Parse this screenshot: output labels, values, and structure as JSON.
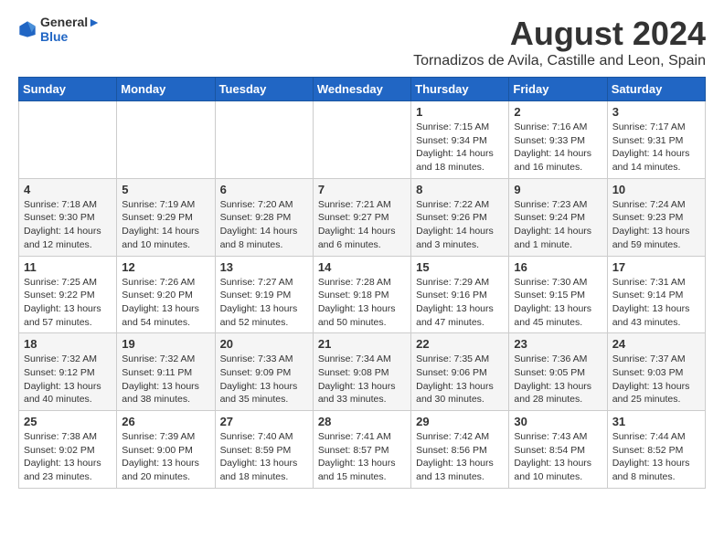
{
  "logo": {
    "line1": "General",
    "line2": "Blue"
  },
  "title": "August 2024",
  "subtitle": "Tornadizos de Avila, Castille and Leon, Spain",
  "days_of_week": [
    "Sunday",
    "Monday",
    "Tuesday",
    "Wednesday",
    "Thursday",
    "Friday",
    "Saturday"
  ],
  "weeks": [
    [
      {
        "day": "",
        "info": ""
      },
      {
        "day": "",
        "info": ""
      },
      {
        "day": "",
        "info": ""
      },
      {
        "day": "",
        "info": ""
      },
      {
        "day": "1",
        "info": "Sunrise: 7:15 AM\nSunset: 9:34 PM\nDaylight: 14 hours\nand 18 minutes."
      },
      {
        "day": "2",
        "info": "Sunrise: 7:16 AM\nSunset: 9:33 PM\nDaylight: 14 hours\nand 16 minutes."
      },
      {
        "day": "3",
        "info": "Sunrise: 7:17 AM\nSunset: 9:31 PM\nDaylight: 14 hours\nand 14 minutes."
      }
    ],
    [
      {
        "day": "4",
        "info": "Sunrise: 7:18 AM\nSunset: 9:30 PM\nDaylight: 14 hours\nand 12 minutes."
      },
      {
        "day": "5",
        "info": "Sunrise: 7:19 AM\nSunset: 9:29 PM\nDaylight: 14 hours\nand 10 minutes."
      },
      {
        "day": "6",
        "info": "Sunrise: 7:20 AM\nSunset: 9:28 PM\nDaylight: 14 hours\nand 8 minutes."
      },
      {
        "day": "7",
        "info": "Sunrise: 7:21 AM\nSunset: 9:27 PM\nDaylight: 14 hours\nand 6 minutes."
      },
      {
        "day": "8",
        "info": "Sunrise: 7:22 AM\nSunset: 9:26 PM\nDaylight: 14 hours\nand 3 minutes."
      },
      {
        "day": "9",
        "info": "Sunrise: 7:23 AM\nSunset: 9:24 PM\nDaylight: 14 hours\nand 1 minute."
      },
      {
        "day": "10",
        "info": "Sunrise: 7:24 AM\nSunset: 9:23 PM\nDaylight: 13 hours\nand 59 minutes."
      }
    ],
    [
      {
        "day": "11",
        "info": "Sunrise: 7:25 AM\nSunset: 9:22 PM\nDaylight: 13 hours\nand 57 minutes."
      },
      {
        "day": "12",
        "info": "Sunrise: 7:26 AM\nSunset: 9:20 PM\nDaylight: 13 hours\nand 54 minutes."
      },
      {
        "day": "13",
        "info": "Sunrise: 7:27 AM\nSunset: 9:19 PM\nDaylight: 13 hours\nand 52 minutes."
      },
      {
        "day": "14",
        "info": "Sunrise: 7:28 AM\nSunset: 9:18 PM\nDaylight: 13 hours\nand 50 minutes."
      },
      {
        "day": "15",
        "info": "Sunrise: 7:29 AM\nSunset: 9:16 PM\nDaylight: 13 hours\nand 47 minutes."
      },
      {
        "day": "16",
        "info": "Sunrise: 7:30 AM\nSunset: 9:15 PM\nDaylight: 13 hours\nand 45 minutes."
      },
      {
        "day": "17",
        "info": "Sunrise: 7:31 AM\nSunset: 9:14 PM\nDaylight: 13 hours\nand 43 minutes."
      }
    ],
    [
      {
        "day": "18",
        "info": "Sunrise: 7:32 AM\nSunset: 9:12 PM\nDaylight: 13 hours\nand 40 minutes."
      },
      {
        "day": "19",
        "info": "Sunrise: 7:32 AM\nSunset: 9:11 PM\nDaylight: 13 hours\nand 38 minutes."
      },
      {
        "day": "20",
        "info": "Sunrise: 7:33 AM\nSunset: 9:09 PM\nDaylight: 13 hours\nand 35 minutes."
      },
      {
        "day": "21",
        "info": "Sunrise: 7:34 AM\nSunset: 9:08 PM\nDaylight: 13 hours\nand 33 minutes."
      },
      {
        "day": "22",
        "info": "Sunrise: 7:35 AM\nSunset: 9:06 PM\nDaylight: 13 hours\nand 30 minutes."
      },
      {
        "day": "23",
        "info": "Sunrise: 7:36 AM\nSunset: 9:05 PM\nDaylight: 13 hours\nand 28 minutes."
      },
      {
        "day": "24",
        "info": "Sunrise: 7:37 AM\nSunset: 9:03 PM\nDaylight: 13 hours\nand 25 minutes."
      }
    ],
    [
      {
        "day": "25",
        "info": "Sunrise: 7:38 AM\nSunset: 9:02 PM\nDaylight: 13 hours\nand 23 minutes."
      },
      {
        "day": "26",
        "info": "Sunrise: 7:39 AM\nSunset: 9:00 PM\nDaylight: 13 hours\nand 20 minutes."
      },
      {
        "day": "27",
        "info": "Sunrise: 7:40 AM\nSunset: 8:59 PM\nDaylight: 13 hours\nand 18 minutes."
      },
      {
        "day": "28",
        "info": "Sunrise: 7:41 AM\nSunset: 8:57 PM\nDaylight: 13 hours\nand 15 minutes."
      },
      {
        "day": "29",
        "info": "Sunrise: 7:42 AM\nSunset: 8:56 PM\nDaylight: 13 hours\nand 13 minutes."
      },
      {
        "day": "30",
        "info": "Sunrise: 7:43 AM\nSunset: 8:54 PM\nDaylight: 13 hours\nand 10 minutes."
      },
      {
        "day": "31",
        "info": "Sunrise: 7:44 AM\nSunset: 8:52 PM\nDaylight: 13 hours\nand 8 minutes."
      }
    ]
  ]
}
